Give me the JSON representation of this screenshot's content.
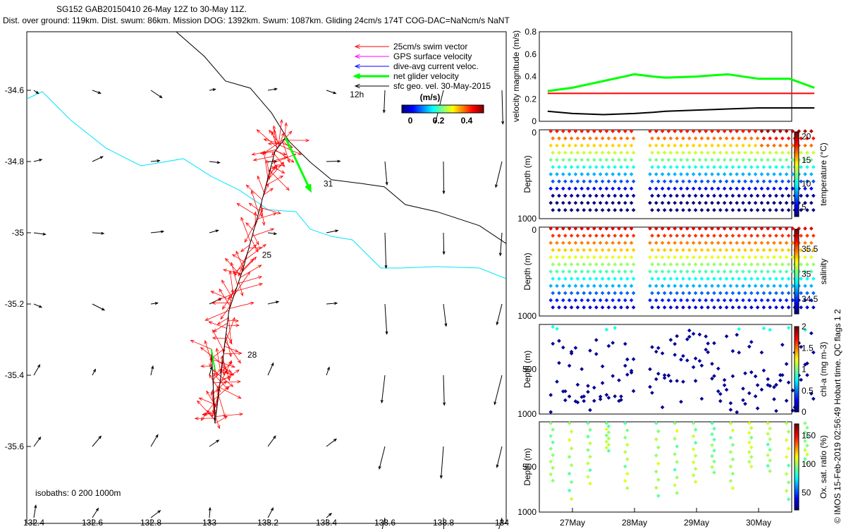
{
  "title": {
    "line1": "SG152 GAB20150410 26-May 12Z to 30-May 11Z.",
    "line2": "Dist. over ground: 119km. Dist. swum: 86km. Mission DOG: 1392km. Swum: 1087km. Gliding 24cm/s 174T COG-DAC=NaNcm/s NaNT"
  },
  "copyright": "© IMOS 15-Feb-2019 02:56:49 Hobart time. QC flags 1  2",
  "chart_data": [
    {
      "type": "map",
      "xlim": [
        132.37,
        134.02
      ],
      "ylim": [
        -35.8,
        -34.45
      ],
      "xticks": [
        "132.4",
        "132.6",
        "132.8",
        "133",
        "133.2",
        "133.4",
        "133.6",
        "133.8",
        "134"
      ],
      "yticks": [
        "-34.6",
        "-34.8",
        "-35",
        "-35.2",
        "-35.4",
        "-35.6"
      ],
      "legend": [
        "25cm/s swim vector",
        "GPS surface velocity",
        "dive-avg current veloc.",
        "net glider velocity",
        "sfc geo. vel. 30-May-2015"
      ],
      "legend_colors": [
        "#ff0000",
        "#ff00ff",
        "#0000ff",
        "#00ff00",
        "#000000"
      ],
      "colorbar": {
        "label": "(m/s)",
        "ticks": [
          "0",
          "0.2",
          "0.4"
        ],
        "range": [
          -0.05,
          0.5
        ]
      },
      "annotation": "isobaths: 0   200  1000m",
      "track_labels": [
        {
          "text": "12h",
          "lon": 133.48,
          "lat": -34.62
        },
        {
          "text": "31",
          "lon": 133.39,
          "lat": -34.87
        },
        {
          "text": "25",
          "lon": 133.18,
          "lat": -35.07
        },
        {
          "text": "28",
          "lon": 133.13,
          "lat": -35.35
        }
      ],
      "isobath_200": [
        [
          132.376,
          -34.624
        ],
        [
          132.429,
          -34.604
        ],
        [
          132.525,
          -34.683
        ],
        [
          132.646,
          -34.762
        ],
        [
          132.766,
          -34.812
        ],
        [
          132.911,
          -34.792
        ],
        [
          133.007,
          -34.842
        ],
        [
          133.104,
          -34.881
        ],
        [
          133.2,
          -34.935
        ],
        [
          133.296,
          -34.941
        ],
        [
          133.345,
          -34.99
        ],
        [
          133.417,
          -35.01
        ],
        [
          133.489,
          -35.02
        ],
        [
          133.586,
          -35.099
        ],
        [
          133.658,
          -35.099
        ],
        [
          133.778,
          -35.095
        ],
        [
          133.923,
          -35.099
        ],
        [
          134.014,
          -35.129
        ]
      ],
      "isobath_1000": [
        [
          132.887,
          -34.436
        ],
        [
          132.983,
          -34.505
        ],
        [
          133.055,
          -34.574
        ],
        [
          133.14,
          -34.594
        ],
        [
          133.212,
          -34.663
        ],
        [
          133.272,
          -34.743
        ],
        [
          133.345,
          -34.802
        ],
        [
          133.417,
          -34.851
        ],
        [
          133.513,
          -34.861
        ],
        [
          133.598,
          -34.871
        ],
        [
          133.67,
          -34.921
        ],
        [
          133.778,
          -34.941
        ],
        [
          133.923,
          -34.98
        ],
        [
          134.014,
          -35.03
        ]
      ],
      "track": [
        [
          133.007,
          -35.327
        ],
        [
          133.019,
          -35.535
        ],
        [
          133.043,
          -35.376
        ],
        [
          133.067,
          -35.218
        ],
        [
          133.116,
          -35.099
        ],
        [
          133.176,
          -34.921
        ],
        [
          133.224,
          -34.772
        ],
        [
          133.26,
          -34.733
        ]
      ],
      "net_velocity_end": [
        133.345,
        -34.881
      ]
    },
    {
      "type": "line",
      "ylabel": "velocity magnitude (m/s)",
      "ylim": [
        0,
        0.8
      ],
      "yticks": [
        "0",
        "0.2",
        "0.4",
        "0.6",
        "0.8"
      ],
      "x": [
        "26.6",
        "27",
        "27.5",
        "28",
        "28.3",
        "28.5",
        "29",
        "29.5",
        "30",
        "30.5",
        "30.9"
      ],
      "series": [
        {
          "color": "#00ff00",
          "values": [
            0.27,
            0.3,
            0.36,
            0.42,
            0.4,
            0.39,
            0.4,
            0.42,
            0.38,
            0.38,
            0.3
          ]
        },
        {
          "color": "#ff0000",
          "values": [
            0.25,
            0.25,
            0.25,
            0.25,
            0.25,
            0.25,
            0.25,
            0.25,
            0.25,
            0.25,
            0.25
          ]
        },
        {
          "color": "#000000",
          "values": [
            0.09,
            0.07,
            0.06,
            0.07,
            0.08,
            0.09,
            0.1,
            0.11,
            0.12,
            0.12,
            0.12
          ]
        }
      ]
    },
    {
      "type": "scatter",
      "ylabel": "Depth (m)",
      "yticks": [
        "0",
        "",
        "1000"
      ],
      "clabel": "temperature (°C)",
      "cticks": [
        "5",
        "10",
        "15",
        "20"
      ],
      "crange": [
        3,
        21
      ]
    },
    {
      "type": "scatter",
      "ylabel": "Depth (m)",
      "yticks": [
        "0",
        "",
        "1000"
      ],
      "clabel": "salinity",
      "cticks": [
        "34.5",
        "35",
        "35.5"
      ],
      "crange": [
        34.2,
        35.9
      ]
    },
    {
      "type": "scatter",
      "ylabel": "Depth (m)",
      "yticks": [
        "",
        "500",
        "1000"
      ],
      "clabel": "chl-a (mg m-3)",
      "cticks": [
        "0",
        "0.5",
        "1",
        "1.5",
        "2"
      ],
      "crange": [
        0,
        2
      ]
    },
    {
      "type": "scatter",
      "ylabel": "Depth (m)",
      "yticks": [
        "",
        "500",
        "1000"
      ],
      "clabel": "Ox. sat. ratio (%)",
      "cticks": [
        "50",
        "100",
        "150"
      ],
      "crange": [
        20,
        170
      ]
    }
  ],
  "date_ticks": [
    "27May",
    "28May",
    "29May",
    "30May"
  ]
}
